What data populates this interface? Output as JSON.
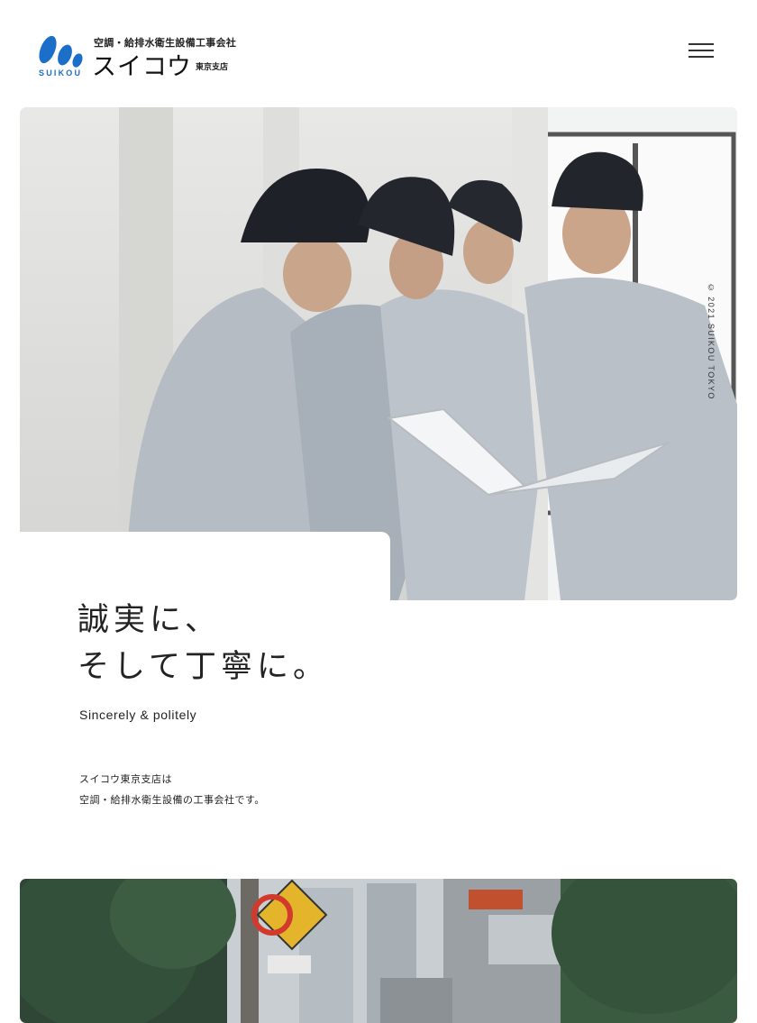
{
  "header": {
    "logo": {
      "tagline": "空調・給排水衛生設備工事会社",
      "name": "スイコウ",
      "branch": "東京支店",
      "english": "SUIKOU",
      "mark_color": "#1b6fc8"
    },
    "menu_icon": "hamburger-icon"
  },
  "hero": {
    "copyright": "© 2021 SUIKOU TOKYO",
    "title_lines": [
      "誠実に、",
      "そして丁寧に。"
    ],
    "subtitle": "Sincerely & politely",
    "description_lines": [
      "スイコウ東京支店は",
      "空調・給排水衛生設備の工事会社です。"
    ]
  },
  "colors": {
    "brand_blue": "#1b6fc8",
    "text": "#222222",
    "background": "#ffffff"
  }
}
